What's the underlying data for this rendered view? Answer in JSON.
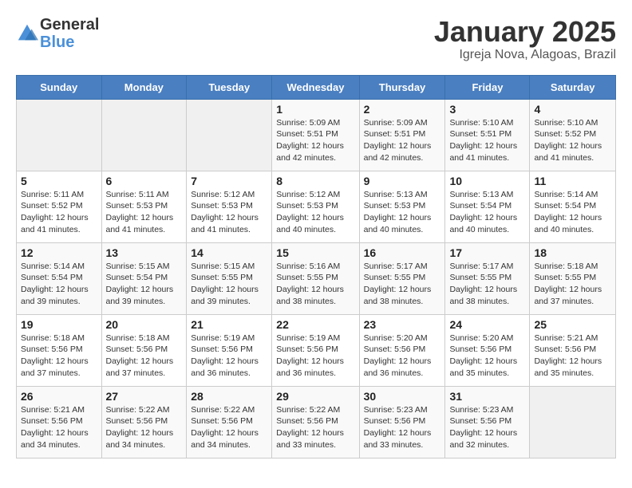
{
  "header": {
    "logo_general": "General",
    "logo_blue": "Blue",
    "month_title": "January 2025",
    "location": "Igreja Nova, Alagoas, Brazil"
  },
  "weekdays": [
    "Sunday",
    "Monday",
    "Tuesday",
    "Wednesday",
    "Thursday",
    "Friday",
    "Saturday"
  ],
  "weeks": [
    [
      {
        "day": "",
        "info": ""
      },
      {
        "day": "",
        "info": ""
      },
      {
        "day": "",
        "info": ""
      },
      {
        "day": "1",
        "info": "Sunrise: 5:09 AM\nSunset: 5:51 PM\nDaylight: 12 hours and 42 minutes."
      },
      {
        "day": "2",
        "info": "Sunrise: 5:09 AM\nSunset: 5:51 PM\nDaylight: 12 hours and 42 minutes."
      },
      {
        "day": "3",
        "info": "Sunrise: 5:10 AM\nSunset: 5:51 PM\nDaylight: 12 hours and 41 minutes."
      },
      {
        "day": "4",
        "info": "Sunrise: 5:10 AM\nSunset: 5:52 PM\nDaylight: 12 hours and 41 minutes."
      }
    ],
    [
      {
        "day": "5",
        "info": "Sunrise: 5:11 AM\nSunset: 5:52 PM\nDaylight: 12 hours and 41 minutes."
      },
      {
        "day": "6",
        "info": "Sunrise: 5:11 AM\nSunset: 5:53 PM\nDaylight: 12 hours and 41 minutes."
      },
      {
        "day": "7",
        "info": "Sunrise: 5:12 AM\nSunset: 5:53 PM\nDaylight: 12 hours and 41 minutes."
      },
      {
        "day": "8",
        "info": "Sunrise: 5:12 AM\nSunset: 5:53 PM\nDaylight: 12 hours and 40 minutes."
      },
      {
        "day": "9",
        "info": "Sunrise: 5:13 AM\nSunset: 5:53 PM\nDaylight: 12 hours and 40 minutes."
      },
      {
        "day": "10",
        "info": "Sunrise: 5:13 AM\nSunset: 5:54 PM\nDaylight: 12 hours and 40 minutes."
      },
      {
        "day": "11",
        "info": "Sunrise: 5:14 AM\nSunset: 5:54 PM\nDaylight: 12 hours and 40 minutes."
      }
    ],
    [
      {
        "day": "12",
        "info": "Sunrise: 5:14 AM\nSunset: 5:54 PM\nDaylight: 12 hours and 39 minutes."
      },
      {
        "day": "13",
        "info": "Sunrise: 5:15 AM\nSunset: 5:54 PM\nDaylight: 12 hours and 39 minutes."
      },
      {
        "day": "14",
        "info": "Sunrise: 5:15 AM\nSunset: 5:55 PM\nDaylight: 12 hours and 39 minutes."
      },
      {
        "day": "15",
        "info": "Sunrise: 5:16 AM\nSunset: 5:55 PM\nDaylight: 12 hours and 38 minutes."
      },
      {
        "day": "16",
        "info": "Sunrise: 5:17 AM\nSunset: 5:55 PM\nDaylight: 12 hours and 38 minutes."
      },
      {
        "day": "17",
        "info": "Sunrise: 5:17 AM\nSunset: 5:55 PM\nDaylight: 12 hours and 38 minutes."
      },
      {
        "day": "18",
        "info": "Sunrise: 5:18 AM\nSunset: 5:55 PM\nDaylight: 12 hours and 37 minutes."
      }
    ],
    [
      {
        "day": "19",
        "info": "Sunrise: 5:18 AM\nSunset: 5:56 PM\nDaylight: 12 hours and 37 minutes."
      },
      {
        "day": "20",
        "info": "Sunrise: 5:18 AM\nSunset: 5:56 PM\nDaylight: 12 hours and 37 minutes."
      },
      {
        "day": "21",
        "info": "Sunrise: 5:19 AM\nSunset: 5:56 PM\nDaylight: 12 hours and 36 minutes."
      },
      {
        "day": "22",
        "info": "Sunrise: 5:19 AM\nSunset: 5:56 PM\nDaylight: 12 hours and 36 minutes."
      },
      {
        "day": "23",
        "info": "Sunrise: 5:20 AM\nSunset: 5:56 PM\nDaylight: 12 hours and 36 minutes."
      },
      {
        "day": "24",
        "info": "Sunrise: 5:20 AM\nSunset: 5:56 PM\nDaylight: 12 hours and 35 minutes."
      },
      {
        "day": "25",
        "info": "Sunrise: 5:21 AM\nSunset: 5:56 PM\nDaylight: 12 hours and 35 minutes."
      }
    ],
    [
      {
        "day": "26",
        "info": "Sunrise: 5:21 AM\nSunset: 5:56 PM\nDaylight: 12 hours and 34 minutes."
      },
      {
        "day": "27",
        "info": "Sunrise: 5:22 AM\nSunset: 5:56 PM\nDaylight: 12 hours and 34 minutes."
      },
      {
        "day": "28",
        "info": "Sunrise: 5:22 AM\nSunset: 5:56 PM\nDaylight: 12 hours and 34 minutes."
      },
      {
        "day": "29",
        "info": "Sunrise: 5:22 AM\nSunset: 5:56 PM\nDaylight: 12 hours and 33 minutes."
      },
      {
        "day": "30",
        "info": "Sunrise: 5:23 AM\nSunset: 5:56 PM\nDaylight: 12 hours and 33 minutes."
      },
      {
        "day": "31",
        "info": "Sunrise: 5:23 AM\nSunset: 5:56 PM\nDaylight: 12 hours and 32 minutes."
      },
      {
        "day": "",
        "info": ""
      }
    ]
  ]
}
